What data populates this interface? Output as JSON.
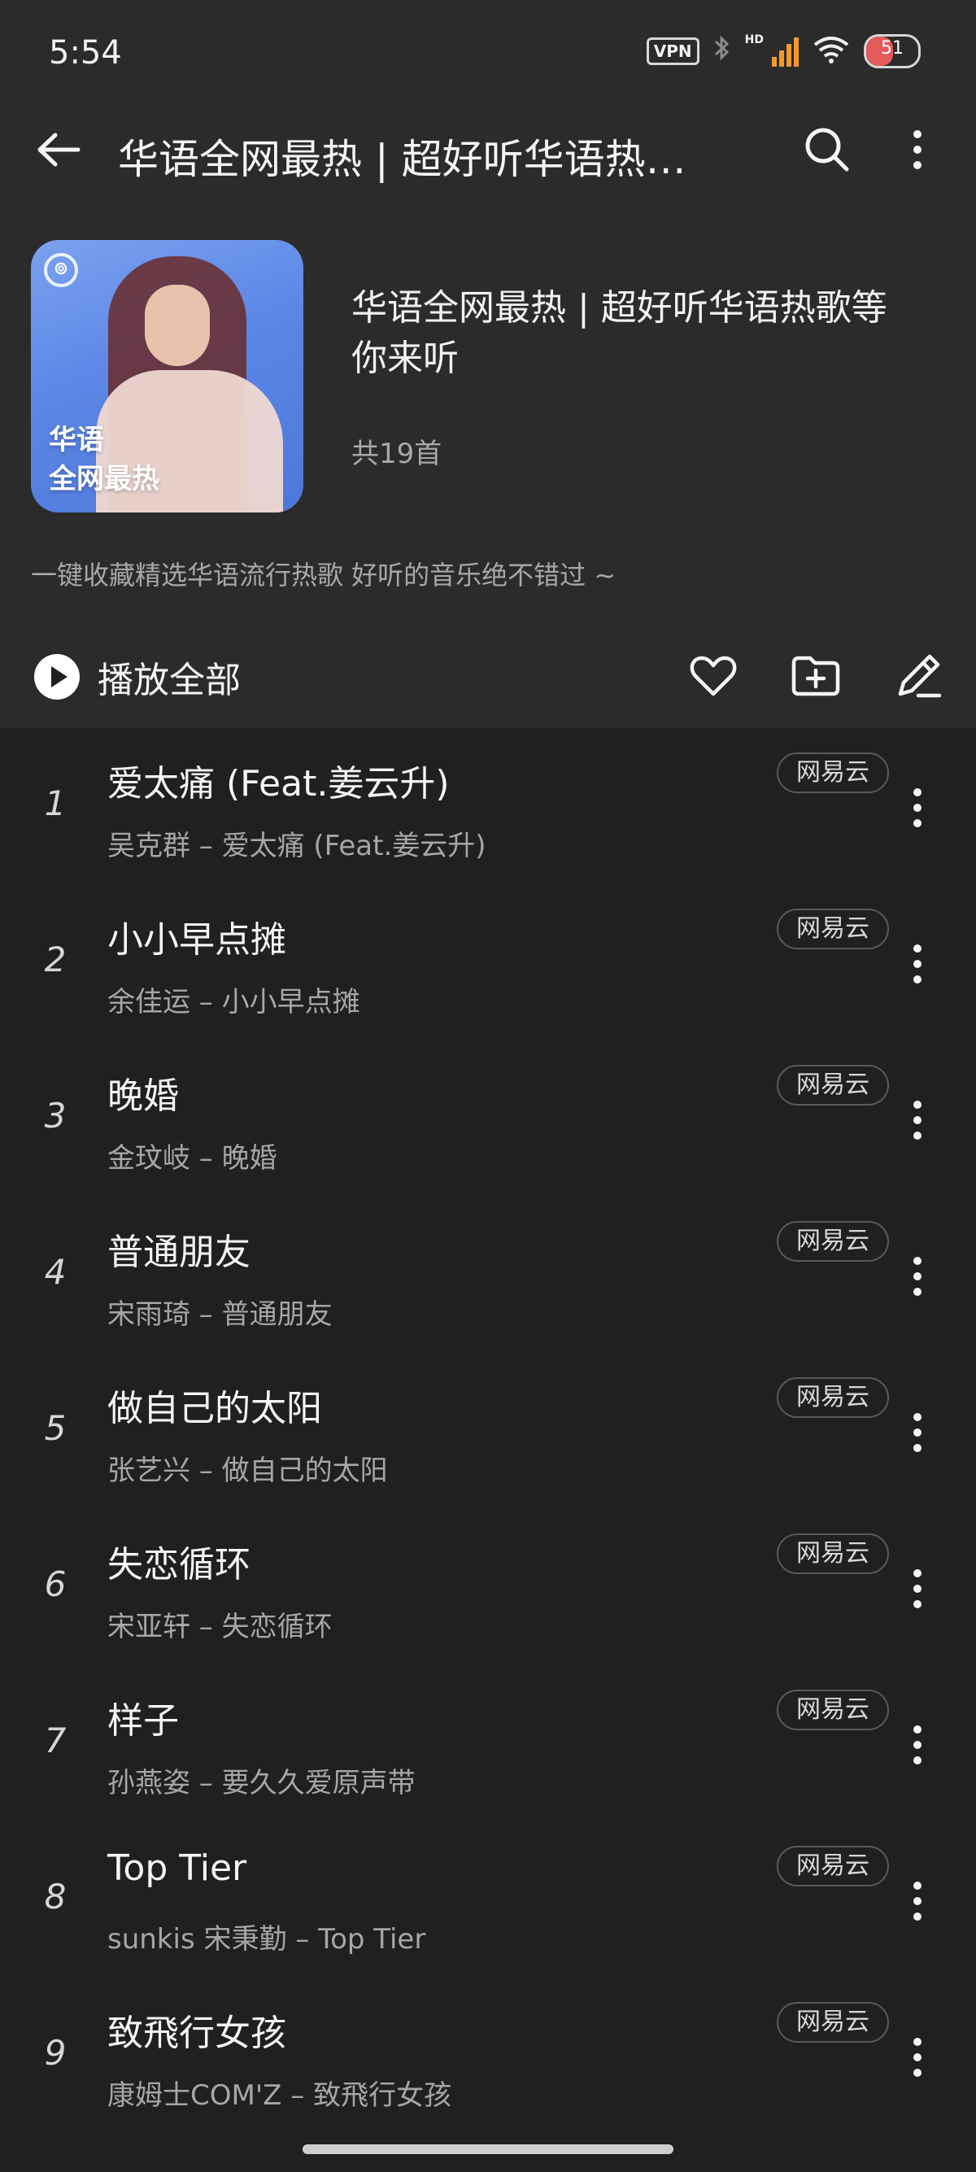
{
  "status_bar": {
    "time": "5:54",
    "vpn_label": "VPN",
    "hd_label": "HD",
    "battery_level": "51",
    "battery_color": "#e35b5b",
    "signal_color": "#f39a2b"
  },
  "topbar": {
    "title": "华语全网最热 | 超好听华语热…",
    "back_icon": "arrow-left-icon",
    "search_icon": "search-icon",
    "more_icon": "more-vertical-icon"
  },
  "playlist": {
    "cover_text_line1": "华语",
    "cover_text_line2": "全网最热",
    "cover_logo": "netease-logo",
    "title": "华语全网最热 | 超好听华语热歌等你来听",
    "count": "共19首",
    "description": "一键收藏精选华语流行热歌 好听的音乐绝不错过 ~"
  },
  "actions": {
    "play_all_label": "播放全部",
    "icons": [
      "heart-icon",
      "folder-add-icon",
      "edit-icon"
    ]
  },
  "songs": [
    {
      "index": "1",
      "title": "爱太痛 (Feat.姜云升)",
      "subtitle": "吴克群 – 爱太痛 (Feat.姜云升)",
      "source": "网易云"
    },
    {
      "index": "2",
      "title": "小小早点摊",
      "subtitle": "余佳运 – 小小早点摊",
      "source": "网易云"
    },
    {
      "index": "3",
      "title": "晚婚",
      "subtitle": "金玟岐 – 晚婚",
      "source": "网易云"
    },
    {
      "index": "4",
      "title": "普通朋友",
      "subtitle": "宋雨琦 – 普通朋友",
      "source": "网易云"
    },
    {
      "index": "5",
      "title": "做自己的太阳",
      "subtitle": "张艺兴 – 做自己的太阳",
      "source": "网易云"
    },
    {
      "index": "6",
      "title": "失恋循环",
      "subtitle": "宋亚轩 – 失恋循环",
      "source": "网易云"
    },
    {
      "index": "7",
      "title": "样子",
      "subtitle": "孙燕姿 – 要久久爱原声带",
      "source": "网易云"
    },
    {
      "index": "8",
      "title": "Top Tier",
      "subtitle": "sunkis 宋秉勤 – Top Tier",
      "source": "网易云"
    },
    {
      "index": "9",
      "title": "致飛行女孩",
      "subtitle": "康姆士COM'Z – 致飛行女孩",
      "source": "网易云"
    }
  ],
  "colors": {
    "background": "#202020",
    "header_background": "#2b2b2b",
    "primary_text": "#f5f5f5",
    "secondary_text": "#a6a6a6"
  }
}
